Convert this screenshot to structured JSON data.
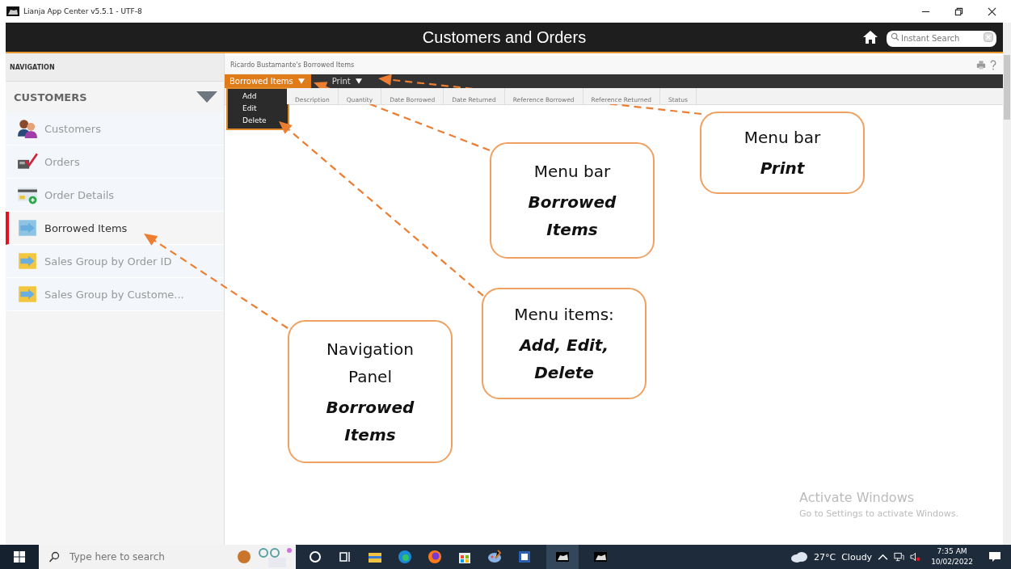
{
  "window": {
    "title": "Lianja App Center v5.5.1 - UTF-8"
  },
  "app_header": {
    "title": "Customers and Orders",
    "search": {
      "placeholder": "Instant Search"
    }
  },
  "navigation": {
    "heading": "NAVIGATION",
    "section": {
      "title": "CUSTOMERS",
      "expanded": true
    },
    "items": [
      {
        "label": "Customers",
        "selected": false
      },
      {
        "label": "Orders",
        "selected": false
      },
      {
        "label": "Order Details",
        "selected": false
      },
      {
        "label": "Borrowed Items",
        "selected": true
      },
      {
        "label": "Sales Group by Order ID",
        "selected": false
      },
      {
        "label": "Sales Group by Custome...",
        "selected": false
      }
    ]
  },
  "page": {
    "breadcrumb": "Ricardo Bustamante's Borrowed Items",
    "menus": [
      {
        "label": "Borrowed Items",
        "selected": true
      },
      {
        "label": "Print",
        "selected": false
      }
    ],
    "dropdown": [
      "Add",
      "Edit",
      "Delete"
    ],
    "columns": [
      "Description",
      "Quantity",
      "Date Borrowed",
      "Date Returned",
      "Reference Borrowed",
      "Reference Returned",
      "Status"
    ]
  },
  "callouts": [
    {
      "title": "Menu bar",
      "subject": "Print"
    },
    {
      "title": "Menu bar",
      "subject": "Borrowed Items"
    },
    {
      "title": "Menu items:",
      "subject": "Add, Edit, Delete"
    },
    {
      "title": "Navigation Panel",
      "subject": "Borrowed Items"
    }
  ],
  "activation_notice": {
    "title": "Activate Windows",
    "text": "Go to Settings to activate Windows."
  },
  "taskbar": {
    "search": {
      "placeholder": "Type here to search"
    },
    "temperature": "27°C",
    "weather": "Cloudy",
    "time": "7:35 AM",
    "date": "10/02/2022"
  }
}
